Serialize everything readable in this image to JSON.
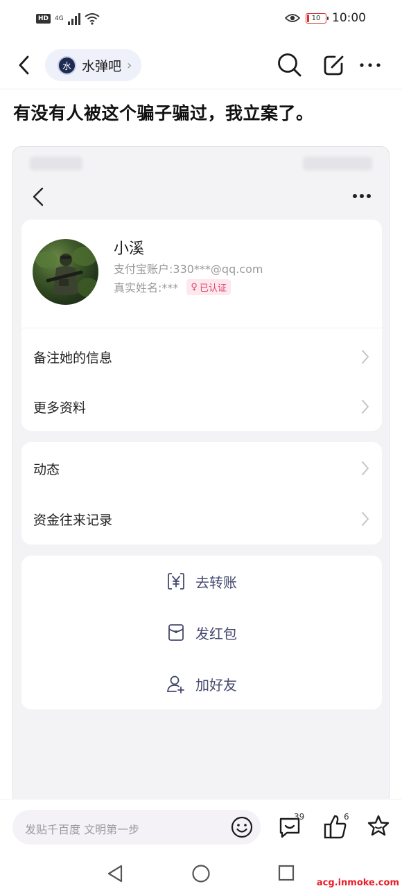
{
  "status_bar": {
    "hd": "HD",
    "network": "4G",
    "battery": "10",
    "battery_level": 0.1,
    "time": "10:00"
  },
  "nav": {
    "forum_logo_text": "水",
    "forum_name": "水弹吧",
    "forum_chevron": "›"
  },
  "post": {
    "title": "有没有人被这个骗子骗过，我立案了。"
  },
  "screenshot": {
    "profile": {
      "name": "小溪",
      "alipay_account": "支付宝账户:330***@qq.com",
      "real_name": "真实姓名:***",
      "verified_label": "已认证",
      "gender_symbol": "♀"
    },
    "rows_group1": [
      "备注她的信息",
      "更多资料"
    ],
    "rows_group2": [
      "动态",
      "资金往来记录"
    ],
    "actions": [
      {
        "label": "去转账",
        "icon": "yuan-transfer-icon"
      },
      {
        "label": "发红包",
        "icon": "red-envelope-icon"
      },
      {
        "label": "加好友",
        "icon": "add-friend-icon"
      }
    ]
  },
  "bottom_bar": {
    "placeholder": "发贴千百度 文明第一步",
    "comment_count": "39",
    "like_count": "6"
  },
  "watermark": "acg.inmoke.com"
}
